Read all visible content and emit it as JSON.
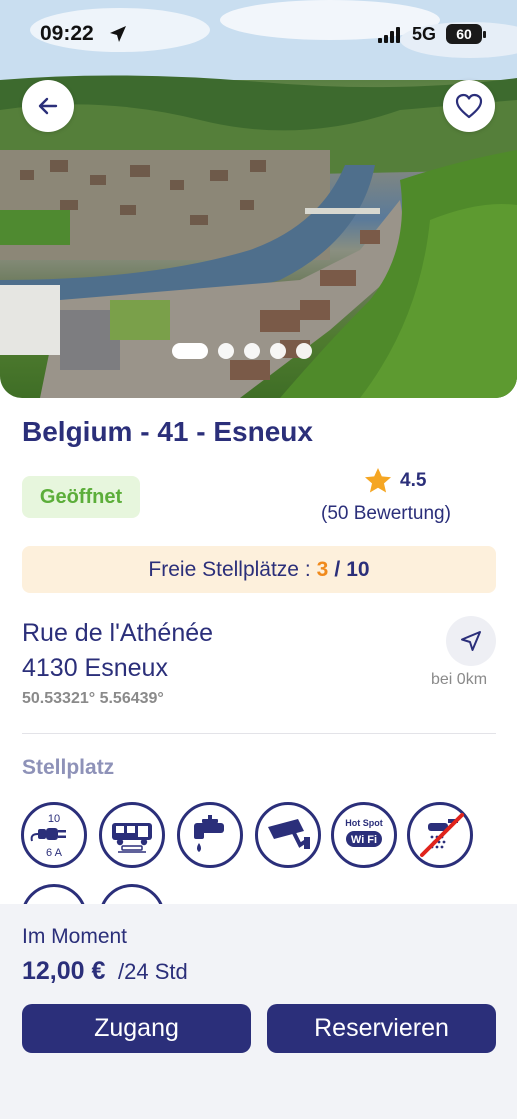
{
  "status_bar": {
    "time": "09:22",
    "network": "5G",
    "battery": "60"
  },
  "hero": {
    "slide_count": 5,
    "active_slide": 1
  },
  "place": {
    "title": "Belgium - 41 - Esneux",
    "status": "Geöffnet",
    "rating": "4.5",
    "rating_count": "(50 Bewertung)"
  },
  "availability": {
    "label": "Freie Stellplätze :",
    "current": "3",
    "separator": "/",
    "total": "10"
  },
  "address": {
    "line1": "Rue de l'Athénée",
    "line2": "4130 Esneux",
    "coords": "50.53321° 5.56439°",
    "distance": "bei 0km"
  },
  "amenities": {
    "section_title": "Stellplatz",
    "items": [
      {
        "name": "electricity",
        "top_label": "10",
        "bottom_label": "6 A"
      },
      {
        "name": "wastewater"
      },
      {
        "name": "water-tap"
      },
      {
        "name": "camera"
      },
      {
        "name": "wifi",
        "top_label": "Hot Spot",
        "bottom_label": "Wi Fi"
      },
      {
        "name": "no-shower"
      }
    ]
  },
  "pricing": {
    "label": "Im Moment",
    "price": "12,00 €",
    "period": "/24 Std"
  },
  "actions": {
    "access": "Zugang",
    "reserve": "Reservieren"
  },
  "colors": {
    "primary": "#2b2f7a",
    "accent": "#f08a1c",
    "open_bg": "#e7f6dd",
    "open_text": "#5cae3a",
    "free_bg": "#fdf0dc",
    "star": "#f5a623"
  }
}
